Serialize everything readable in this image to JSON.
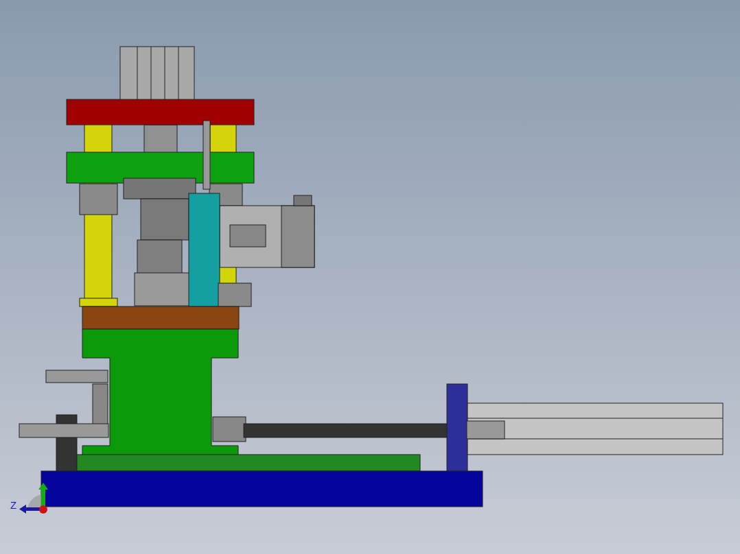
{
  "viewport": {
    "triad": {
      "z_label": "Z"
    }
  }
}
